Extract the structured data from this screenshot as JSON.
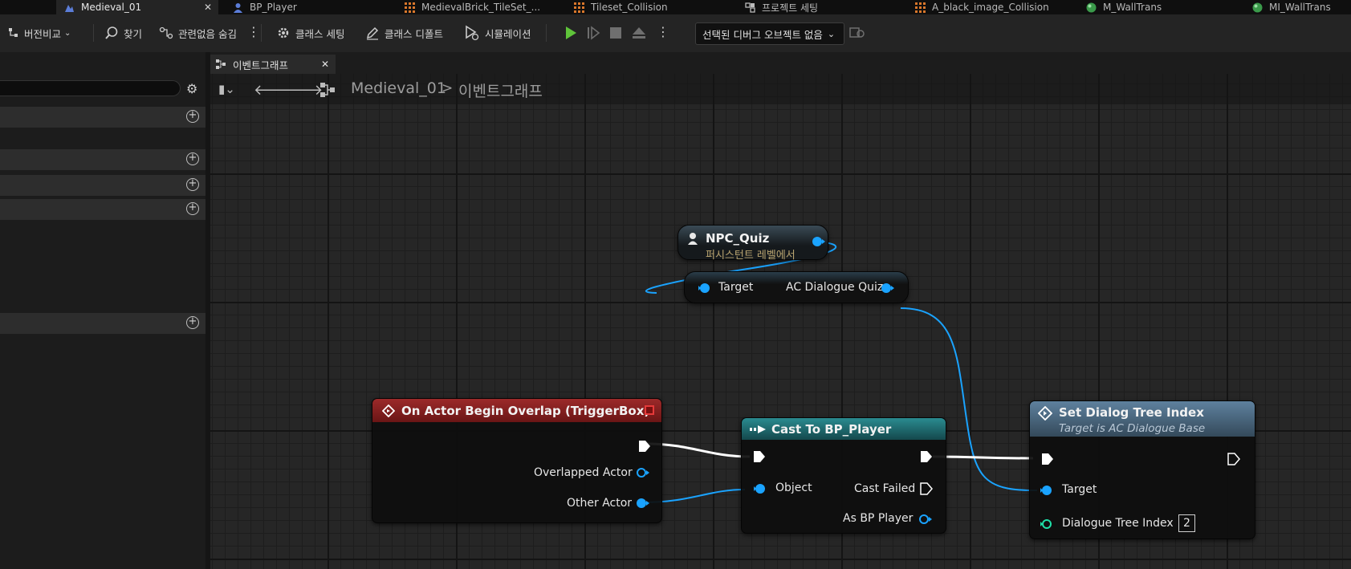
{
  "tabs": [
    {
      "label": "Medieval_01",
      "icon": "level-icon",
      "active": true
    },
    {
      "label": "BP_Player",
      "icon": "blueprint-icon"
    },
    {
      "label": "MedievalBrick_TileSet_...",
      "icon": "tileset-icon"
    },
    {
      "label": "Tileset_Collision",
      "icon": "tileset-icon"
    },
    {
      "label": "프로젝트 세팅",
      "icon": "settings-icon"
    },
    {
      "label": "A_black_image_Collision",
      "icon": "tileset-icon"
    },
    {
      "label": "M_WallTrans",
      "icon": "material-icon"
    },
    {
      "label": "MI_WallTrans",
      "icon": "material-icon"
    }
  ],
  "toolbar": {
    "diff": "버전비교",
    "find": "찾기",
    "hide_unrelated": "관련없음 숨김",
    "class_settings": "클래스 세팅",
    "class_defaults": "클래스 디폴트",
    "simulation": "시뮬레이션",
    "debug_object": "선택된 디버그 오브젝트 없음"
  },
  "graph_tab": {
    "label": "이벤트그래프"
  },
  "breadcrumb": {
    "root": "Medieval_01",
    "separator": ">",
    "current": "이벤트그래프"
  },
  "nodes": {
    "npc": {
      "title": "NPC_Quiz",
      "subtitle": "퍼시스턴트 레벨에서"
    },
    "getter": {
      "in_pin": "Target",
      "out_pin": "AC Dialogue Quiz"
    },
    "overlap": {
      "title": "On Actor Begin Overlap (TriggerBox)",
      "pin1": "Overlapped Actor",
      "pin2": "Other Actor"
    },
    "cast": {
      "title": "Cast To BP_Player",
      "object": "Object",
      "failed": "Cast Failed",
      "as": "As BP Player"
    },
    "setindex": {
      "title": "Set Dialog Tree Index",
      "subtitle": "Target is AC Dialogue Base",
      "target": "Target",
      "index_label": "Dialogue Tree Index",
      "index_value": "2"
    }
  },
  "colors": {
    "pin_object": "#1aa3ff",
    "pin_int": "#1fe0a8",
    "event_header": "#8b1b1b",
    "cast_header": "#1f6b70",
    "func_header": "#4e6f88"
  }
}
